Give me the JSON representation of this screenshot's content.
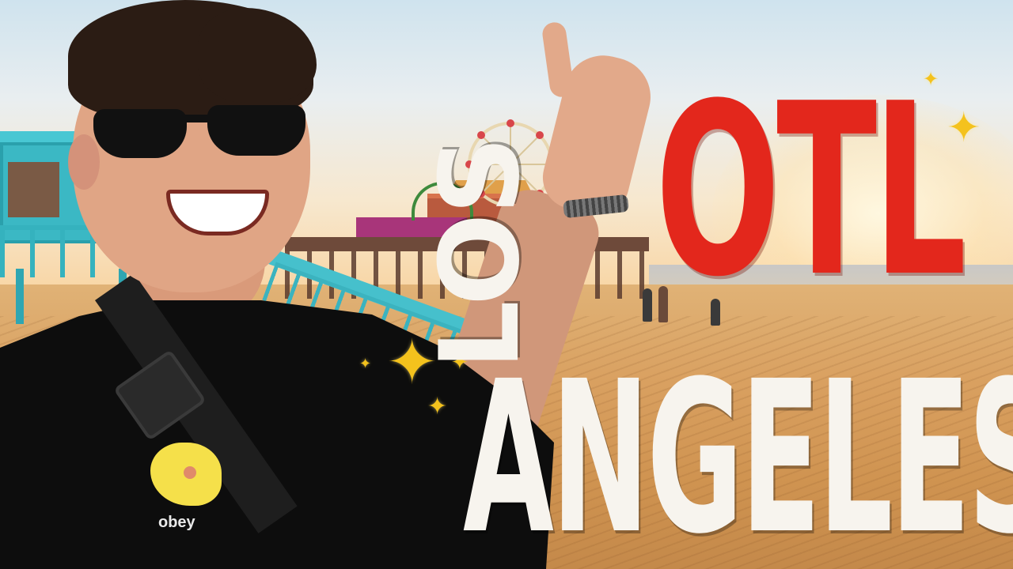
{
  "title": {
    "word_los": "LOS",
    "word_otl": "OTL",
    "word_angeles": "ANGELES"
  },
  "shirt": {
    "logo_text": "obey"
  },
  "colors": {
    "otl_red": "#e3271c",
    "title_white": "#f7f4ee",
    "sparkle_yellow": "#f4c21d",
    "lifeguard_tower_blue": "#3bb8c4",
    "sand": "#d9a060"
  },
  "decorations": {
    "sparkle_glyph": "✦"
  }
}
